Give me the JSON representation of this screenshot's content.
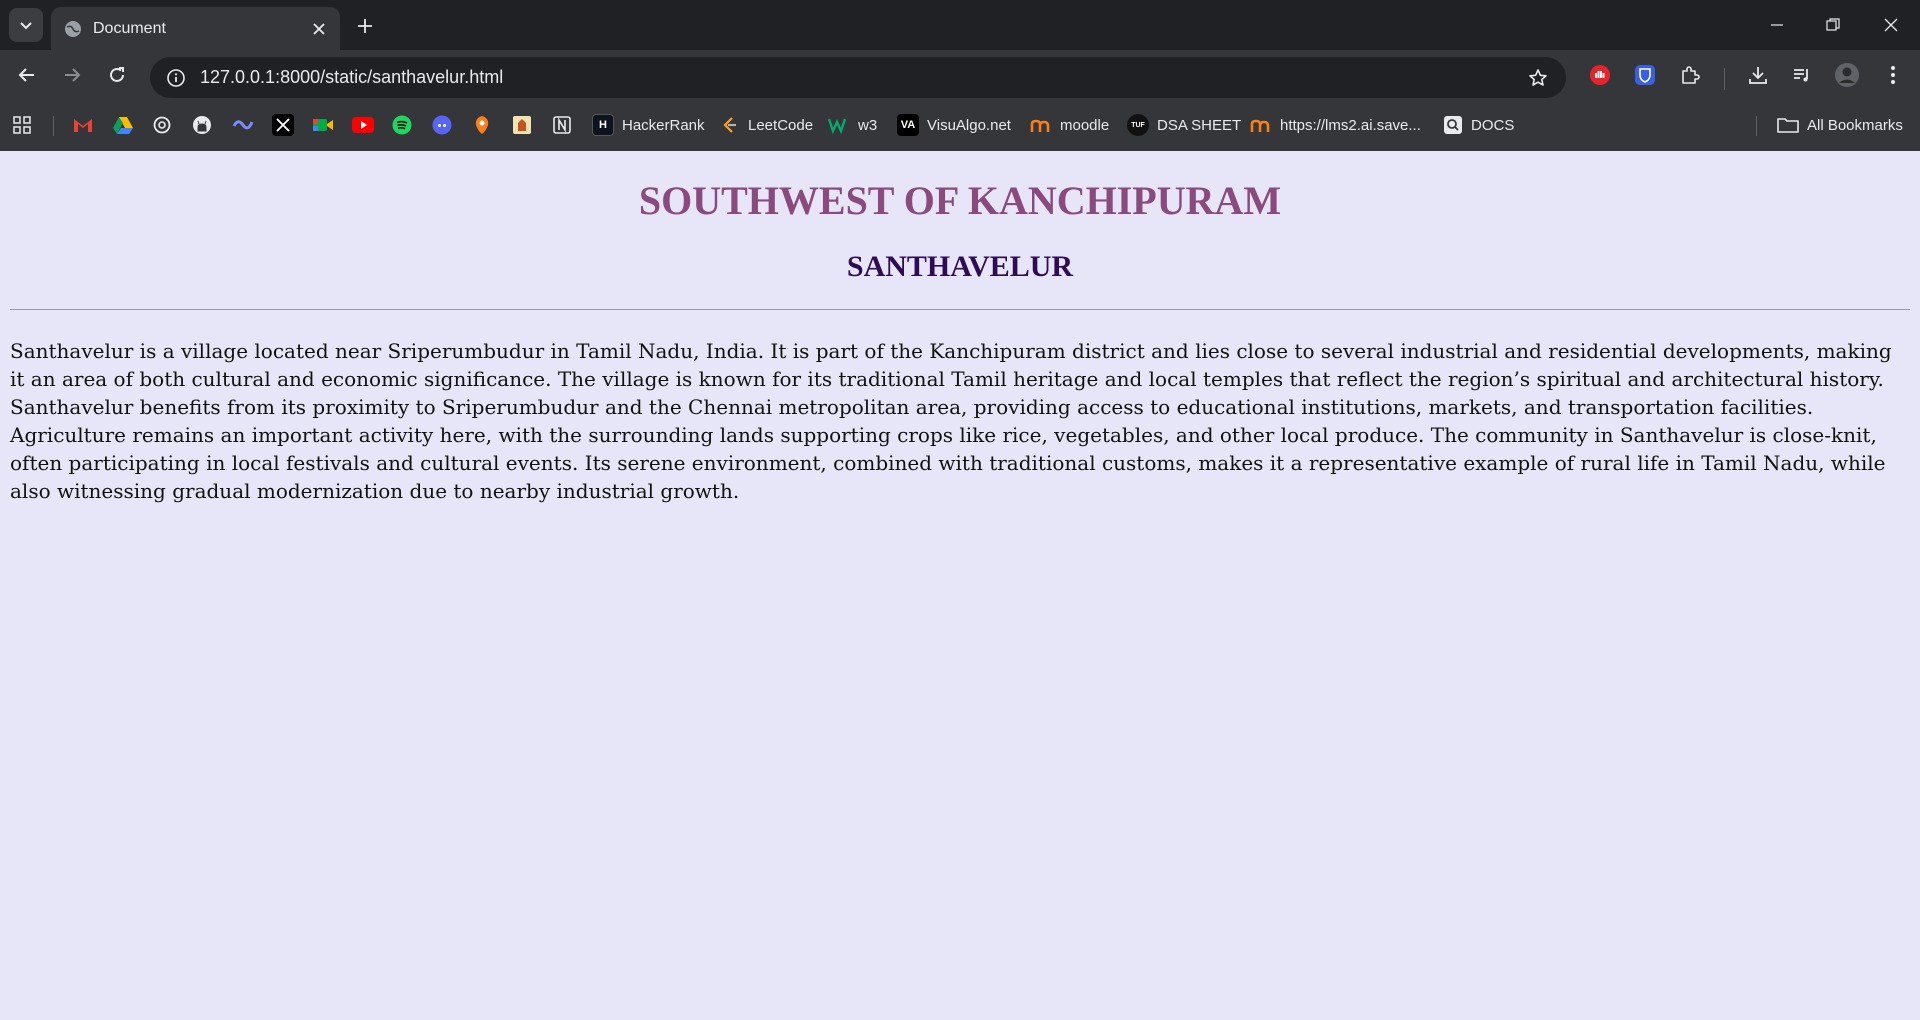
{
  "browser": {
    "tab": {
      "title": "Document"
    },
    "address_bar": {
      "url": "127.0.0.1:8000/static/santhavelur.html"
    },
    "bookmarks": [
      {
        "name": "apps",
        "label": ""
      },
      {
        "name": "gmail",
        "label": ""
      },
      {
        "name": "drive",
        "label": ""
      },
      {
        "name": "chatgpt",
        "label": ""
      },
      {
        "name": "github",
        "label": ""
      },
      {
        "name": "codeium",
        "label": ""
      },
      {
        "name": "x",
        "label": ""
      },
      {
        "name": "meet",
        "label": ""
      },
      {
        "name": "youtube",
        "label": ""
      },
      {
        "name": "spotify",
        "label": ""
      },
      {
        "name": "discord",
        "label": ""
      },
      {
        "name": "swiggy",
        "label": ""
      },
      {
        "name": "gov",
        "label": ""
      },
      {
        "name": "notion",
        "label": ""
      },
      {
        "name": "hackerrank",
        "label": "HackerRank"
      },
      {
        "name": "leetcode",
        "label": "LeetCode"
      },
      {
        "name": "w3",
        "label": "w3"
      },
      {
        "name": "visualgo",
        "label": "VisuAlgo.net"
      },
      {
        "name": "moodle",
        "label": "moodle"
      },
      {
        "name": "dsa-sheet",
        "label": "DSA SHEET"
      },
      {
        "name": "lms",
        "label": "https://lms2.ai.save..."
      },
      {
        "name": "docs",
        "label": "DOCS"
      }
    ],
    "all_bookmarks_label": "All Bookmarks"
  },
  "page": {
    "heading": "SOUTHWEST OF KANCHIPURAM",
    "subheading": "SANTHAVELUR",
    "paragraph": "Santhavelur is a village located near Sriperumbudur in Tamil Nadu, India. It is part of the Kanchipuram district and lies close to several industrial and residential developments, making it an area of both cultural and economic significance. The village is known for its traditional Tamil heritage and local temples that reflect the region’s spiritual and architectural history. Santhavelur benefits from its proximity to Sriperumbudur and the Chennai metropolitan area, providing access to educational institutions, markets, and transportation facilities. Agriculture remains an important activity here, with the surrounding lands supporting crops like rice, vegetables, and other local produce. The community in Santhavelur is close-knit, often participating in local festivals and cultural events. Its serene environment, combined with traditional customs, makes it a representative example of rural life in Tamil Nadu, while also witnessing gradual modernization due to nearby industrial growth."
  },
  "colors": {
    "heading": "#8b4a7d",
    "subheading": "#2f0a55",
    "page_background": "#e6e6f8"
  }
}
